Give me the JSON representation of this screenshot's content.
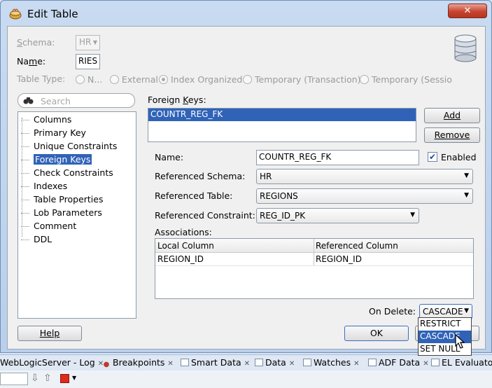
{
  "window": {
    "title": "Edit Table",
    "close_glyph": "✕"
  },
  "header": {
    "schema_label": "Schema:",
    "schema_value": "HR",
    "name_label": "Name:",
    "name_value": "RIES",
    "table_type_label": "Table Type:",
    "table_types": [
      "N...",
      "External",
      "Index Organized",
      "Temporary (Transaction)",
      "Temporary (Sessio"
    ],
    "selected_table_type": "Index Organized"
  },
  "sidebar": {
    "search_placeholder": "Search",
    "items": [
      "Columns",
      "Primary Key",
      "Unique Constraints",
      "Foreign Keys",
      "Check Constraints",
      "Indexes",
      "Table Properties",
      "Lob Parameters",
      "Comment",
      "DDL"
    ],
    "selected": "Foreign Keys"
  },
  "foreign_keys": {
    "label": "Foreign Keys:",
    "list": [
      "COUNTR_REG_FK"
    ],
    "add_label": "Add",
    "remove_label": "Remove",
    "name_label": "Name:",
    "name_value": "COUNTR_REG_FK",
    "enabled_label": "Enabled",
    "enabled": true,
    "ref_schema_label": "Referenced Schema:",
    "ref_schema_value": "HR",
    "ref_table_label": "Referenced Table:",
    "ref_table_value": "REGIONS",
    "ref_constraint_label": "Referenced Constraint:",
    "ref_constraint_value": "REG_ID_PK",
    "associations_label": "Associations:",
    "assoc_headers": [
      "Local Column",
      "Referenced Column"
    ],
    "assoc_rows": [
      [
        "REGION_ID",
        "REGION_ID"
      ]
    ],
    "on_delete_label": "On Delete:",
    "on_delete_value": "CASCADE",
    "on_delete_options": [
      "RESTRICT",
      "CASCADE",
      "SET NULL"
    ]
  },
  "buttons": {
    "help": "Help",
    "ok": "OK"
  },
  "bottom_tabs": [
    {
      "label": "WebLogicServer - Log",
      "icon": ""
    },
    {
      "label": "Breakpoints",
      "icon": "breakpoints-icon"
    },
    {
      "label": "Smart Data",
      "icon": "smart-data-icon"
    },
    {
      "label": "Data",
      "icon": "data-icon"
    },
    {
      "label": "Watches",
      "icon": "watches-icon"
    },
    {
      "label": "ADF Data",
      "icon": "adf-data-icon"
    },
    {
      "label": "EL Evaluato",
      "icon": "el-evaluator-icon"
    }
  ]
}
